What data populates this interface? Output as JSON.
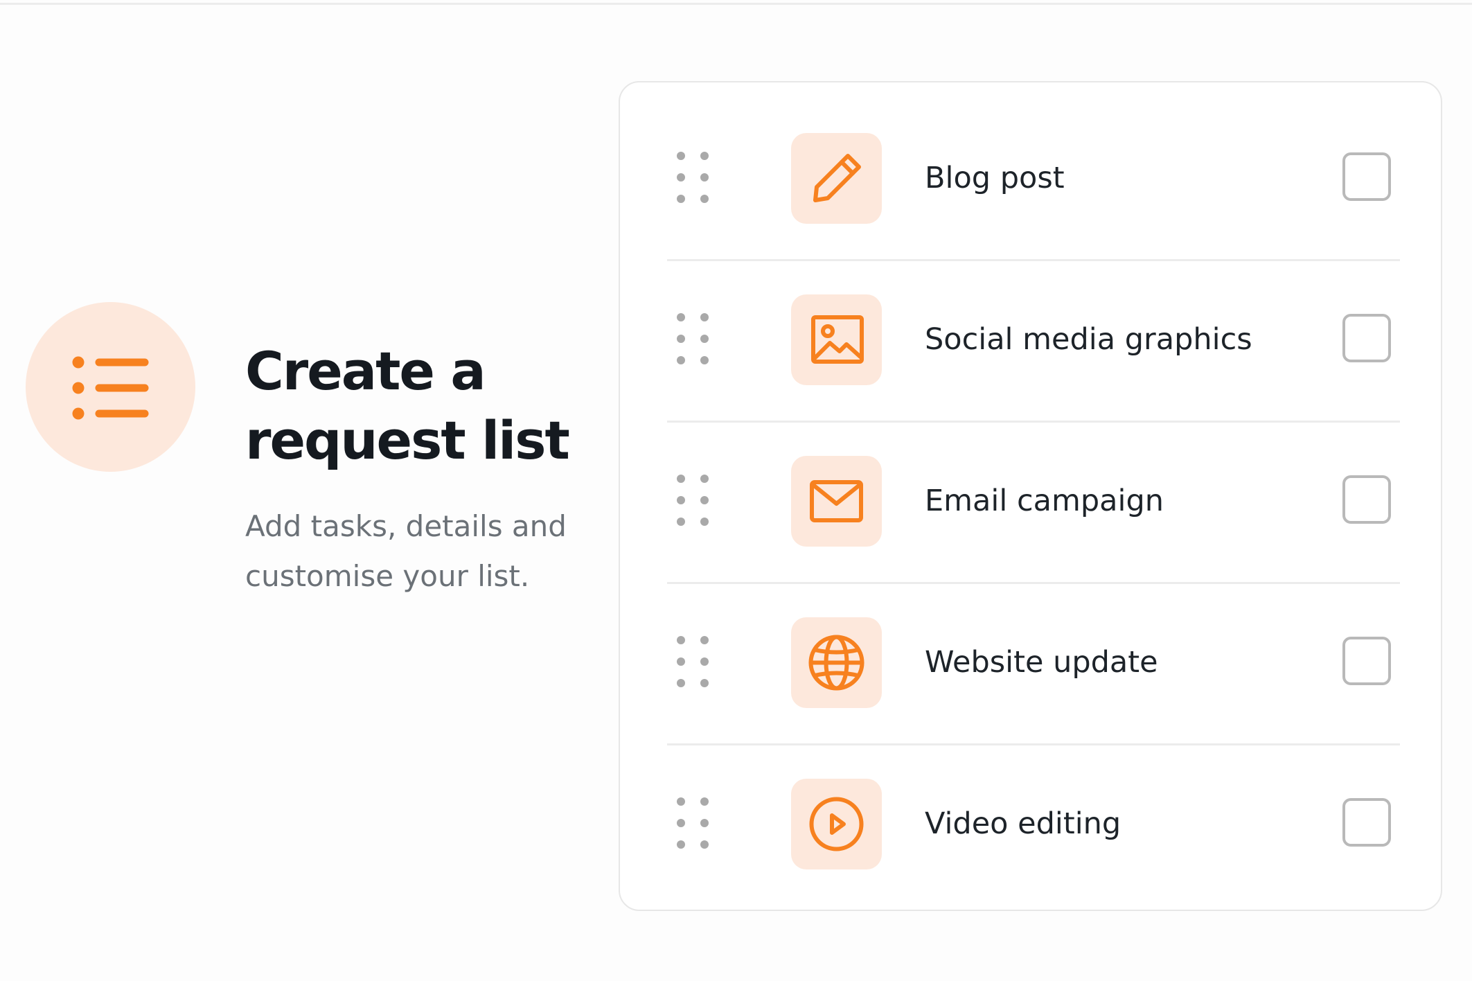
{
  "hero": {
    "icon": "list-icon",
    "title_line1": "Create a",
    "title_line2": "request list",
    "subtitle_line1": "Add tasks, details and",
    "subtitle_line2": "customise your list."
  },
  "colors": {
    "accent": "#f7811f",
    "accent_tint": "#fde8dc",
    "heading": "#151a20",
    "muted_text": "#6b7177",
    "checkbox_border": "#b9b9b9",
    "divider": "#ececec"
  },
  "list": {
    "items": [
      {
        "label": "Blog post",
        "icon": "pencil-icon",
        "checked": false
      },
      {
        "label": "Social media graphics",
        "icon": "image-icon",
        "checked": false
      },
      {
        "label": "Email campaign",
        "icon": "envelope-icon",
        "checked": false
      },
      {
        "label": "Website update",
        "icon": "globe-icon",
        "checked": false
      },
      {
        "label": "Video editing",
        "icon": "play-circle-icon",
        "checked": false
      }
    ]
  }
}
